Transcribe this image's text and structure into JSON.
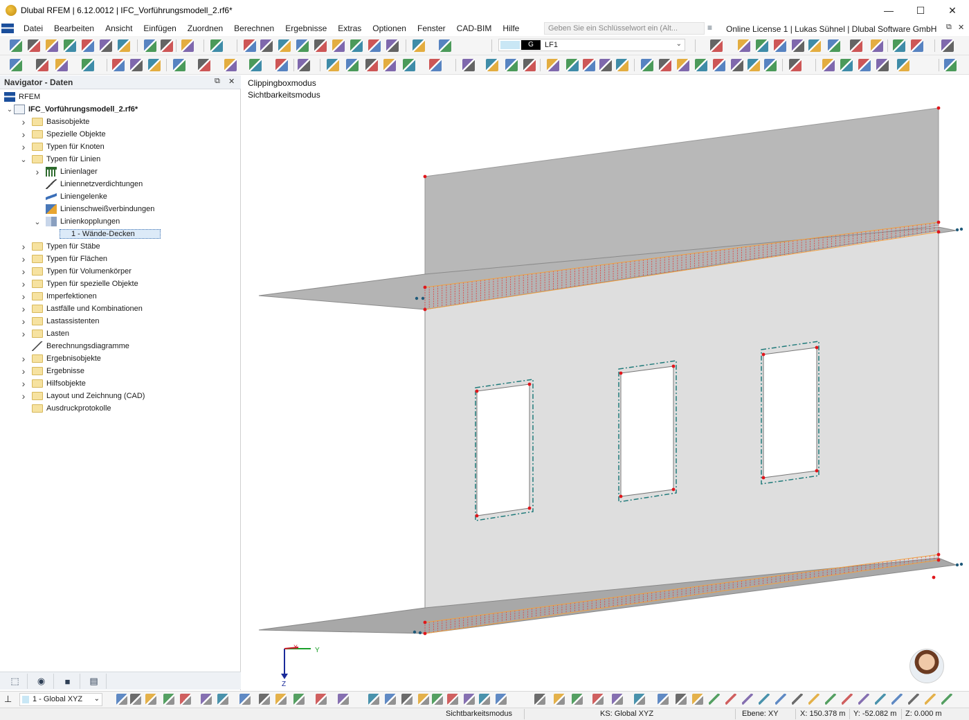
{
  "window": {
    "title": "Dlubal RFEM | 6.12.0012 | IFC_Vorführungsmodell_2.rf6*",
    "minimize": "—",
    "maximize": "☐",
    "close": "✕"
  },
  "menu": {
    "items": [
      "Datei",
      "Bearbeiten",
      "Ansicht",
      "Einfügen",
      "Zuordnen",
      "Berechnen",
      "Ergebnisse",
      "Extras",
      "Optionen",
      "Fenster",
      "CAD-BIM",
      "Hilfe"
    ],
    "search_placeholder": "Geben Sie ein Schlüsselwort ein (Alt...",
    "license": "Online License 1 | Lukas Sühnel | Dlubal Software GmbH"
  },
  "toolbar": {
    "loadcase_tag": "G",
    "loadcase_name": "LF1"
  },
  "navigator": {
    "title": "Navigator - Daten",
    "root": "RFEM",
    "model": "IFC_Vorführungsmodell_2.rf6*",
    "items": [
      {
        "label": "Basisobjekte",
        "level": 1,
        "expand": "closed",
        "icon": "folder"
      },
      {
        "label": "Spezielle Objekte",
        "level": 1,
        "expand": "closed",
        "icon": "folder"
      },
      {
        "label": "Typen für Knoten",
        "level": 1,
        "expand": "closed",
        "icon": "folder"
      },
      {
        "label": "Typen für Linien",
        "level": 1,
        "expand": "open",
        "icon": "folder"
      },
      {
        "label": "Linienlager",
        "level": 2,
        "expand": "closed",
        "icon": "line-support"
      },
      {
        "label": "Liniennetzverdichtungen",
        "level": 2,
        "expand": "none",
        "icon": "mesh-refinement"
      },
      {
        "label": "Liniengelenke",
        "level": 2,
        "expand": "none",
        "icon": "line-hinge"
      },
      {
        "label": "Linienschweißverbindungen",
        "level": 2,
        "expand": "none",
        "icon": "line-weld"
      },
      {
        "label": "Linienkopplungen",
        "level": 2,
        "expand": "open",
        "icon": "line-coupling"
      },
      {
        "label": "1 - Wände-Decken",
        "level": 3,
        "expand": "none",
        "icon": "none",
        "selected": true
      },
      {
        "label": "Typen für Stäbe",
        "level": 1,
        "expand": "closed",
        "icon": "folder"
      },
      {
        "label": "Typen für Flächen",
        "level": 1,
        "expand": "closed",
        "icon": "folder"
      },
      {
        "label": "Typen für Volumenkörper",
        "level": 1,
        "expand": "closed",
        "icon": "folder"
      },
      {
        "label": "Typen für spezielle Objekte",
        "level": 1,
        "expand": "closed",
        "icon": "folder"
      },
      {
        "label": "Imperfektionen",
        "level": 1,
        "expand": "closed",
        "icon": "folder"
      },
      {
        "label": "Lastfälle und Kombinationen",
        "level": 1,
        "expand": "closed",
        "icon": "folder"
      },
      {
        "label": "Lastassistenten",
        "level": 1,
        "expand": "closed",
        "icon": "folder"
      },
      {
        "label": "Lasten",
        "level": 1,
        "expand": "closed",
        "icon": "folder"
      },
      {
        "label": "Berechnungsdiagramme",
        "level": 1,
        "expand": "none",
        "icon": "diagram"
      },
      {
        "label": "Ergebnisobjekte",
        "level": 1,
        "expand": "closed",
        "icon": "folder"
      },
      {
        "label": "Ergebnisse",
        "level": 1,
        "expand": "closed",
        "icon": "folder"
      },
      {
        "label": "Hilfsobjekte",
        "level": 1,
        "expand": "closed",
        "icon": "folder"
      },
      {
        "label": "Layout und Zeichnung (CAD)",
        "level": 1,
        "expand": "closed",
        "icon": "folder"
      },
      {
        "label": "Ausdruckprotokolle",
        "level": 1,
        "expand": "none",
        "icon": "folder"
      }
    ]
  },
  "viewport": {
    "mode1": "Clippingboxmodus",
    "mode2": "Sichtbarkeitsmodus",
    "axis_y": "Y",
    "axis_z": "Z",
    "axis_x": "X"
  },
  "bottom": {
    "coord_system": "1 - Global XYZ"
  },
  "status": {
    "mode": "Sichtbarkeitsmodus",
    "ks": "KS: Global XYZ",
    "plane": "Ebene: XY",
    "x": "X: 150.378 m",
    "y": "Y: -52.082 m",
    "z": "Z: 0.000 m"
  },
  "colors": {
    "wall": "#dcdcdc",
    "wall_upper": "#b5b5b5",
    "slab": "#a9a9a9",
    "coupling": "#e23a3a",
    "opening_line": "#1f7a7a",
    "node": "#e0161b"
  }
}
